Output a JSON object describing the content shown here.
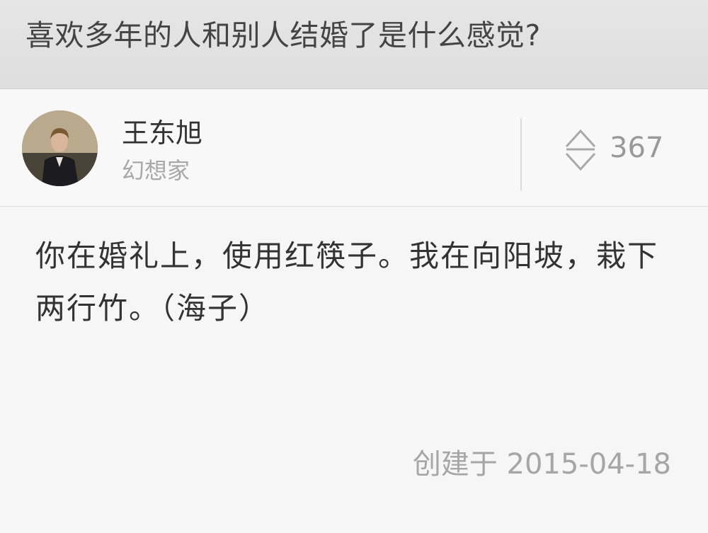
{
  "question": {
    "title": "喜欢多年的人和别人结婚了是什么感觉?"
  },
  "author": {
    "name": "王东旭",
    "bio": "幻想家",
    "avatar_icon": "avatar-photo"
  },
  "vote": {
    "icon": "up-down-vote-icon",
    "count": "367"
  },
  "answer": {
    "text": "你在婚礼上，使用红筷子。我在向阳坡，栽下两行竹。（海子）"
  },
  "meta": {
    "created": "创建于 2015-04-18"
  }
}
